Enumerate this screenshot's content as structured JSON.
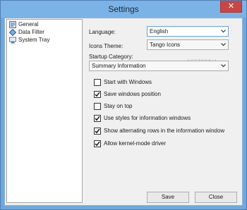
{
  "window": {
    "title": "Settings",
    "close_glyph": "✕"
  },
  "tree": {
    "items": [
      {
        "label": "General",
        "icon": "settings-sheet-icon"
      },
      {
        "label": "Data Filter",
        "icon": "filter-diamond-icon"
      },
      {
        "label": "System Tray",
        "icon": "tray-icon"
      }
    ]
  },
  "form": {
    "language_label": "Language:",
    "language_value": "English",
    "icons_theme_label": "Icons Theme:",
    "icons_theme_value": "Tango Icons",
    "startup_label": "Startup Category:",
    "startup_value": "Summary Information"
  },
  "options": [
    {
      "label": "Start with Windows",
      "checked": false
    },
    {
      "label": "Save windows position",
      "checked": true
    },
    {
      "label": "Stay on top",
      "checked": false
    },
    {
      "label": "Use styles for information windows",
      "checked": true
    },
    {
      "label": "Show alternating rows in the information window",
      "checked": true
    },
    {
      "label": "Allow kernel-mode driver",
      "checked": true
    }
  ],
  "buttons": {
    "save": "Save",
    "close": "Close"
  }
}
